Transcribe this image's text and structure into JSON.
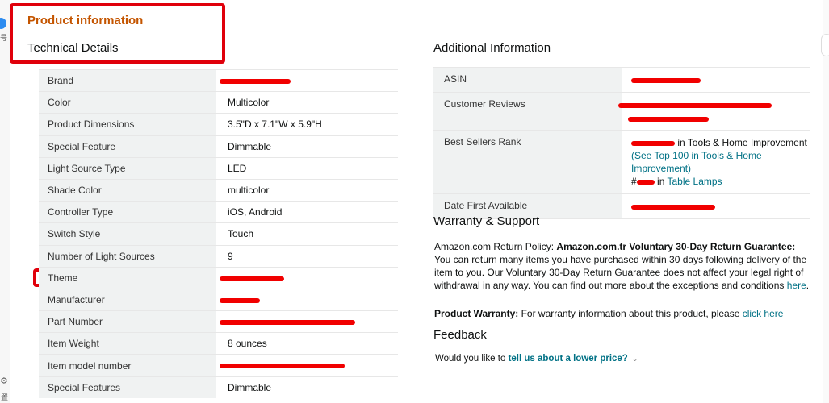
{
  "header": {
    "section_title": "Product information",
    "technical_details_title": "Technical Details"
  },
  "sidebar": {
    "top_label": "号",
    "bottom_label": "置"
  },
  "technical_details": [
    {
      "label": "Brand",
      "value": ""
    },
    {
      "label": "Color",
      "value": "Multicolor"
    },
    {
      "label": "Product Dimensions",
      "value": "3.5\"D x 7.1\"W x 5.9\"H"
    },
    {
      "label": "Special Feature",
      "value": "Dimmable"
    },
    {
      "label": "Light Source Type",
      "value": "LED"
    },
    {
      "label": "Shade Color",
      "value": "multicolor"
    },
    {
      "label": "Controller Type",
      "value": "iOS, Android"
    },
    {
      "label": "Switch Style",
      "value": "Touch"
    },
    {
      "label": "Number of Light Sources",
      "value": "9"
    },
    {
      "label": "Theme",
      "value": ""
    },
    {
      "label": "Manufacturer",
      "value": ""
    },
    {
      "label": "Part Number",
      "value": ""
    },
    {
      "label": "Item Weight",
      "value": "8 ounces"
    },
    {
      "label": "Item model number",
      "value": ""
    },
    {
      "label": "Special Features",
      "value": "Dimmable"
    }
  ],
  "additional": {
    "title": "Additional Information",
    "asin_label": "ASIN",
    "reviews_label": "Customer Reviews",
    "rank_label": "Best Sellers Rank",
    "rank_line1": "in Tools & Home Improvement",
    "rank_see_top": "(See Top 100 in Tools & Home Improvement)",
    "rank_hash": "#",
    "rank_line3_link": "Table Lamps",
    "rank_line3_in": "in",
    "date_label": "Date First Available"
  },
  "warranty": {
    "title": "Warranty & Support",
    "policy_prefix": "Amazon.com Return Policy:",
    "policy_bold": "Amazon.com.tr Voluntary 30-Day Return Guarantee:",
    "policy_body": "You can return many items you have purchased within 30 days following delivery of the item to you. Our Voluntary 30-Day Return Guarantee does not affect your legal right of withdrawal in any way. You can find out more about the exceptions and conditions",
    "policy_link": "here",
    "product_warranty_label": "Product Warranty:",
    "product_warranty_text": "For warranty information about this product, please",
    "product_warranty_link": "click here"
  },
  "feedback": {
    "title": "Feedback",
    "prompt": "Would you like to",
    "link": "tell us about a lower price?",
    "chevron": "⌄"
  },
  "colors": {
    "section_title": "#c45500",
    "link": "#007185",
    "annotation_red": "#e0000b",
    "redaction_red": "#f10000",
    "key_bg": "#f0f2f2"
  }
}
